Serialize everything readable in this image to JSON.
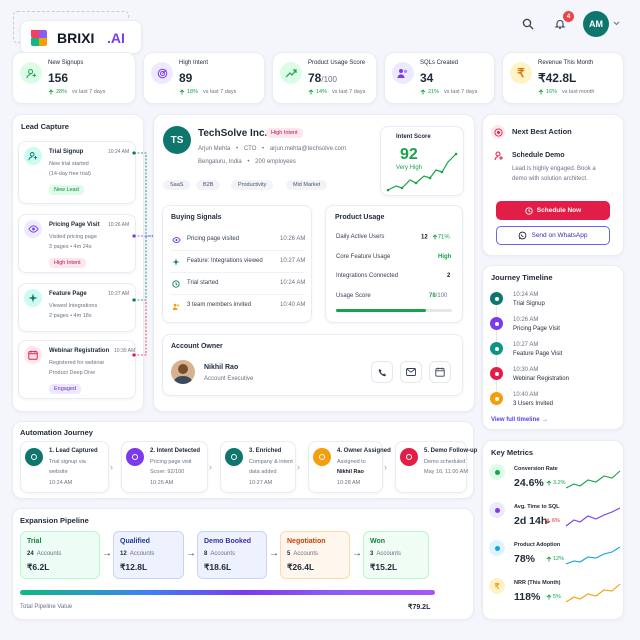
{
  "brand": {
    "name": "BRIXI",
    "suffix": ".AI"
  },
  "topbar": {
    "notification_count": "4",
    "avatar": "AM"
  },
  "kpis": [
    {
      "label": "New Signups",
      "value": "156",
      "unit": "",
      "delta": "28%",
      "period": "vs last 7 days"
    },
    {
      "label": "High Intent",
      "value": "89",
      "unit": "",
      "delta": "18%",
      "period": "vs last 7 days"
    },
    {
      "label": "Product Usage Score",
      "value": "78",
      "unit": "/100",
      "delta": "14%",
      "period": "vs last 7 days"
    },
    {
      "label": "SQLs Created",
      "value": "34",
      "unit": "",
      "delta": "21%",
      "period": "vs last 7 days"
    },
    {
      "label": "Revenue This Month",
      "value": "₹42.8L",
      "unit": "",
      "delta": "16%",
      "period": "vs last month"
    }
  ],
  "lead_capture": {
    "title": "Lead Capture",
    "items": [
      {
        "title": "Trial Signup",
        "time": "10:24 AM",
        "line1": "New trial started",
        "line2": "(14-day free trial)",
        "tag": "New Lead"
      },
      {
        "title": "Pricing Page Visit",
        "time": "10:26 AM",
        "line1": "Visited pricing page",
        "line2": "3 pages  •  4m 24s",
        "tag": "High Intent"
      },
      {
        "title": "Feature Page",
        "time": "10:27 AM",
        "line1": "Viewed Integrations",
        "line2": "2 pages  •  4m 18s",
        "tag": ""
      },
      {
        "title": "Webinar Registration",
        "time": "10:30 AM",
        "line1": "Registered for webinar",
        "line2": "Product Deep Dive",
        "tag": "Engaged"
      }
    ]
  },
  "account": {
    "initials": "TS",
    "name": "TechSolve Inc.",
    "badge": "High Intent",
    "contact": "Arjun Mehta",
    "role": "CTO",
    "email": "arjun.mehta@techsolve.com",
    "location": "Bengaluru, India",
    "employees": "200 employees",
    "tags": [
      "SaaS",
      "B2B",
      "Productivity",
      "Mid Market"
    ],
    "intent_label": "Intent Score",
    "intent_value": "92",
    "intent_level": "Very High"
  },
  "signals": {
    "title": "Buying Signals",
    "items": [
      {
        "text": "Pricing page visited",
        "time": "10:26 AM"
      },
      {
        "text": "Feature: Integrations viewed",
        "time": "10:27 AM"
      },
      {
        "text": "Trial started",
        "time": "10:24 AM"
      },
      {
        "text": "3 team members invited",
        "time": "10:40 AM"
      }
    ]
  },
  "usage": {
    "title": "Product Usage",
    "rows": [
      {
        "label": "Daily Active Users",
        "value": "12",
        "delta": "71%"
      },
      {
        "label": "Core Feature Usage",
        "value": "High",
        "delta": ""
      },
      {
        "label": "Integrations Connected",
        "value": "2",
        "delta": ""
      },
      {
        "label": "Usage Score",
        "value": "78",
        "unit": "/100",
        "delta": ""
      }
    ],
    "score_fraction": 0.78
  },
  "owner": {
    "title": "Account Owner",
    "name": "Nikhil Rao",
    "role": "Account Executive"
  },
  "next_action": {
    "title": "Next Best Action",
    "heading": "Schedule Demo",
    "body": "Lead is highly engaged. Book a demo with solution architect.",
    "primary": "Schedule Now",
    "secondary": "Send on WhatsApp"
  },
  "journey": {
    "title": "Journey Timeline",
    "items": [
      {
        "time": "10:24 AM",
        "label": "Trial Signup"
      },
      {
        "time": "10:26 AM",
        "label": "Pricing Page Visit"
      },
      {
        "time": "10:27 AM",
        "label": "Feature Page Visit"
      },
      {
        "time": "10:30 AM",
        "label": "Webinar Registration"
      },
      {
        "time": "10:40 AM",
        "label": "3 Users Invited"
      }
    ],
    "link": "View full timeline"
  },
  "automation": {
    "title": "Automation Journey",
    "steps": [
      {
        "title": "1. Lead Captured",
        "l1": "Trial signup via",
        "l2": "website",
        "l3": "10:24 AM"
      },
      {
        "title": "2. Intent Detected",
        "l1": "Pricing page visit",
        "l2": "Score: 92/100",
        "l3": "10:26 AM"
      },
      {
        "title": "3. Enriched",
        "l1": "Company & intent",
        "l2": "data added",
        "l3": "10:27 AM"
      },
      {
        "title": "4. Owner Assigned",
        "l1": "Assigned to",
        "l2": "Nikhil Rao",
        "l3": "10:28 AM"
      },
      {
        "title": "5. Demo Follow-up",
        "l1": "Demo scheduled",
        "l2": "May 16, 11:00 AM",
        "l3": ""
      }
    ]
  },
  "pipeline": {
    "title": "Expansion Pipeline",
    "stages": [
      {
        "name": "Trial",
        "count": "24",
        "unit": "Accounts",
        "value": "₹6.2L"
      },
      {
        "name": "Qualified",
        "count": "12",
        "unit": "Accounts",
        "value": "₹12.8L"
      },
      {
        "name": "Demo Booked",
        "count": "8",
        "unit": "Accounts",
        "value": "₹18.6L"
      },
      {
        "name": "Negotiation",
        "count": "5",
        "unit": "Accounts",
        "value": "₹26.4L"
      },
      {
        "name": "Won",
        "count": "3",
        "unit": "Accounts",
        "value": "₹15.2L"
      }
    ],
    "total_label": "Total Pipeline Value",
    "total_value": "₹79.2L"
  },
  "metrics": {
    "title": "Key Metrics",
    "items": [
      {
        "label": "Conversion Rate",
        "value": "24.6%",
        "delta": "3.2%",
        "dir": "up"
      },
      {
        "label": "Avg. Time to SQL",
        "value": "2d 14h",
        "delta": "6%",
        "dir": "down"
      },
      {
        "label": "Product Adoption",
        "value": "78%",
        "delta": "12%",
        "dir": "up"
      },
      {
        "label": "NRR (This Month)",
        "value": "118%",
        "delta": "5%",
        "dir": "up"
      }
    ]
  },
  "colors": {
    "accent": "#7c3aed",
    "green": "#16a34a",
    "red": "#e11d48",
    "teal": "#0f766e"
  }
}
